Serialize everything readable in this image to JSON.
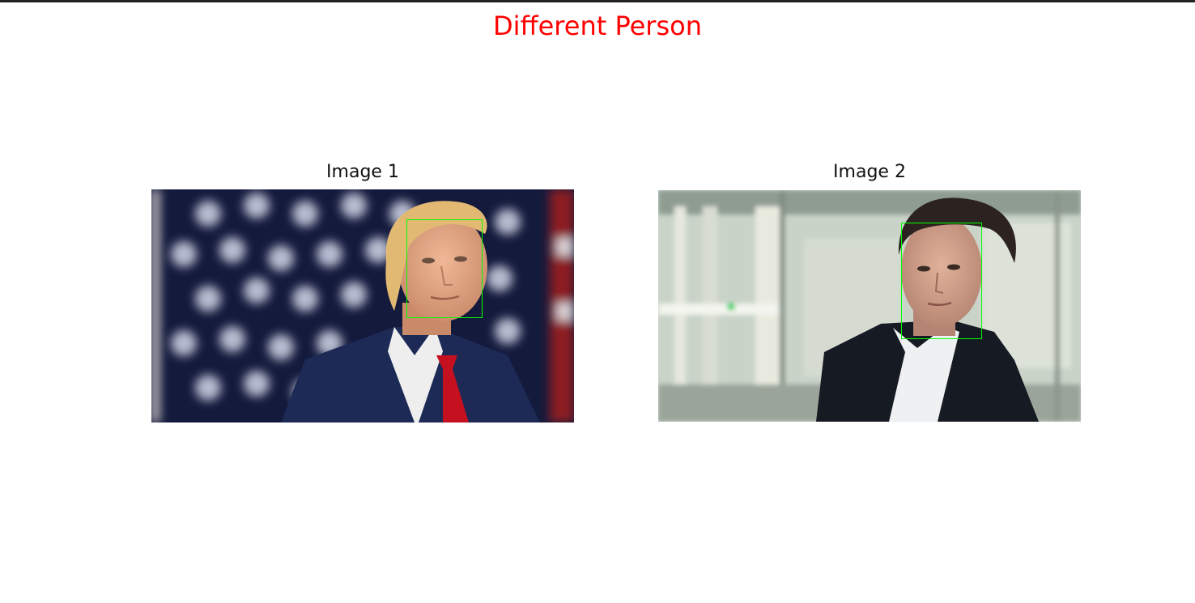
{
  "figure": {
    "suptitle": "Different Person",
    "suptitle_color": "#ff0000",
    "panels": [
      {
        "title": "Image 1",
        "face_box_color": "#00ff00"
      },
      {
        "title": "Image 2",
        "face_box_color": "#00ff00"
      }
    ]
  }
}
